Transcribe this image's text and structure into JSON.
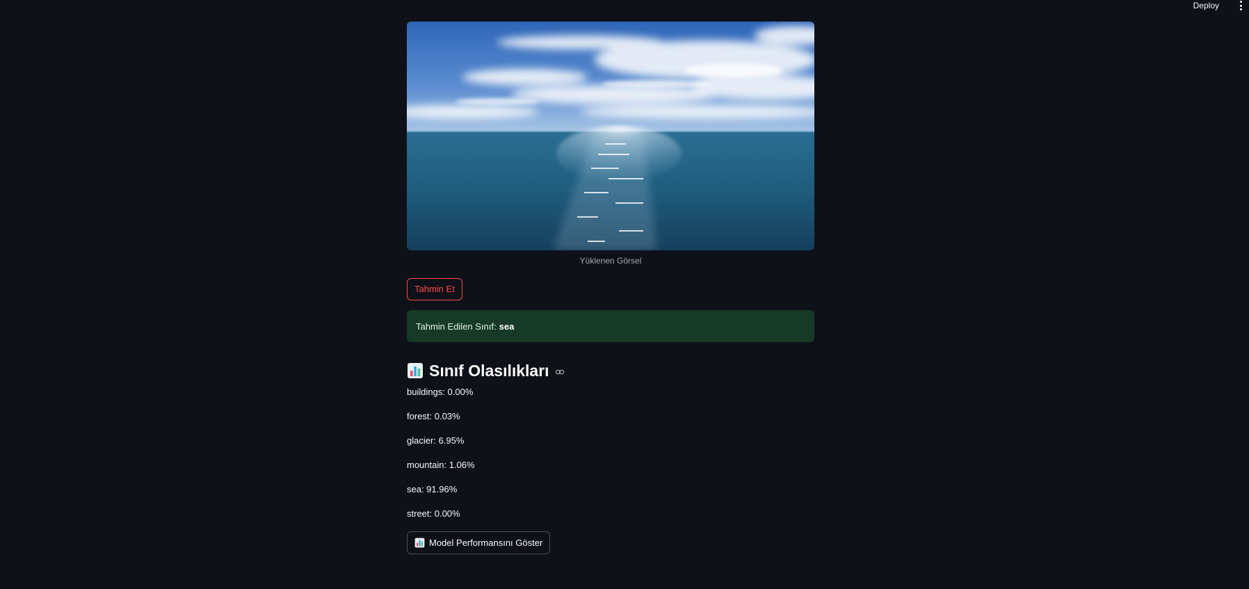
{
  "topbar": {
    "deploy_label": "Deploy",
    "menu_icon": "vertical-ellipsis-icon"
  },
  "image": {
    "caption": "Yüklenen Görsel"
  },
  "predict_button": {
    "label": "Tahmin Et"
  },
  "result": {
    "prefix": "Tahmin Edilen Sınıf:",
    "class": "sea"
  },
  "probabilities": {
    "icon": "bar-chart-icon",
    "title": "Sınıf Olasılıkları",
    "items": [
      "buildings: 0.00%",
      "forest: 0.03%",
      "glacier: 6.95%",
      "mountain: 1.06%",
      "sea: 91.96%",
      "street: 0.00%"
    ]
  },
  "performance_button": {
    "icon": "bar-chart-icon",
    "label": "Model Performansını Göster"
  },
  "colors": {
    "background": "#0e1117",
    "accent": "#ff4b4b",
    "success_bg": "#173928"
  }
}
